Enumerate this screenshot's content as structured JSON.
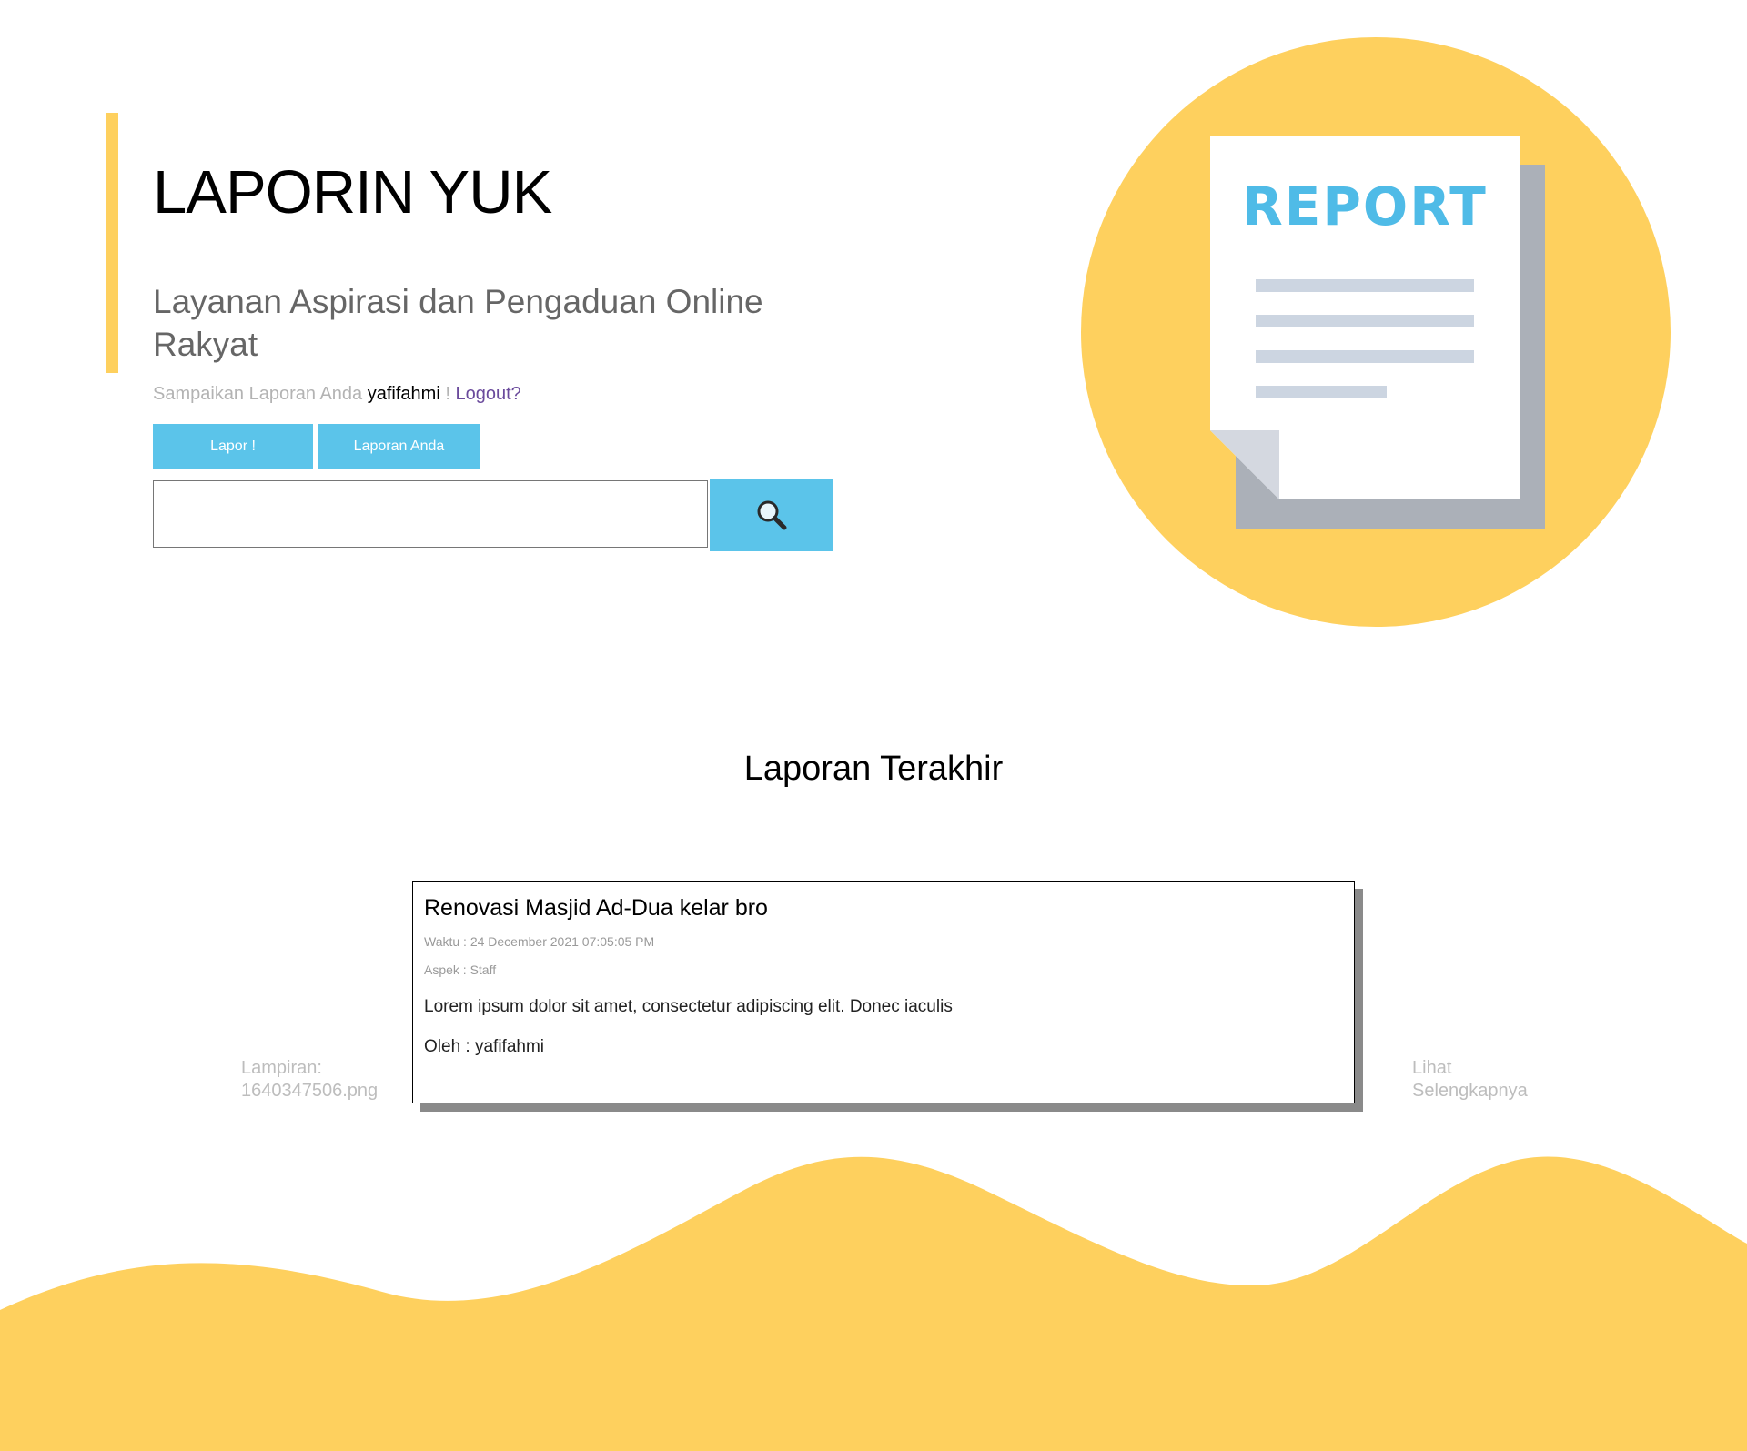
{
  "hero": {
    "title": "LAPORIN YUK",
    "subtitle": "Layanan Aspirasi dan Pengaduan Online Rakyat",
    "greeting_prefix": "Sampaikan Laporan Anda",
    "username": "yafifahmi",
    "greeting_separator": "!",
    "logout_label": "Logout?",
    "buttons": {
      "lapor": "Lapor !",
      "laporan_anda": "Laporan Anda"
    },
    "search": {
      "value": "",
      "placeholder": "",
      "button_icon": "search-icon"
    },
    "illustration": {
      "label": "REPORT",
      "icon": "report-document-icon"
    }
  },
  "latest": {
    "section_title": "Laporan Terakhir",
    "attachment_label": "Lampiran: 1640347506.png",
    "read_more_label": "Lihat Selengkapnya",
    "report": {
      "title": "Renovasi Masjid Ad-Dua kelar bro",
      "time": "Waktu : 24 December 2021 07:05:05 PM",
      "aspect": "Aspek : Staff",
      "body": "Lorem ipsum dolor sit amet, consectetur adipiscing elit. Donec iaculis",
      "author": "Oleh : yafifahmi"
    }
  },
  "colors": {
    "accent_yellow": "#fed05e",
    "button_blue": "#5bc4ea",
    "report_blue": "#4fbbe7",
    "paper_shadow": "#abb0b8",
    "text_lines": "#ccd5e1",
    "logout_purple": "#6a4a9c"
  }
}
